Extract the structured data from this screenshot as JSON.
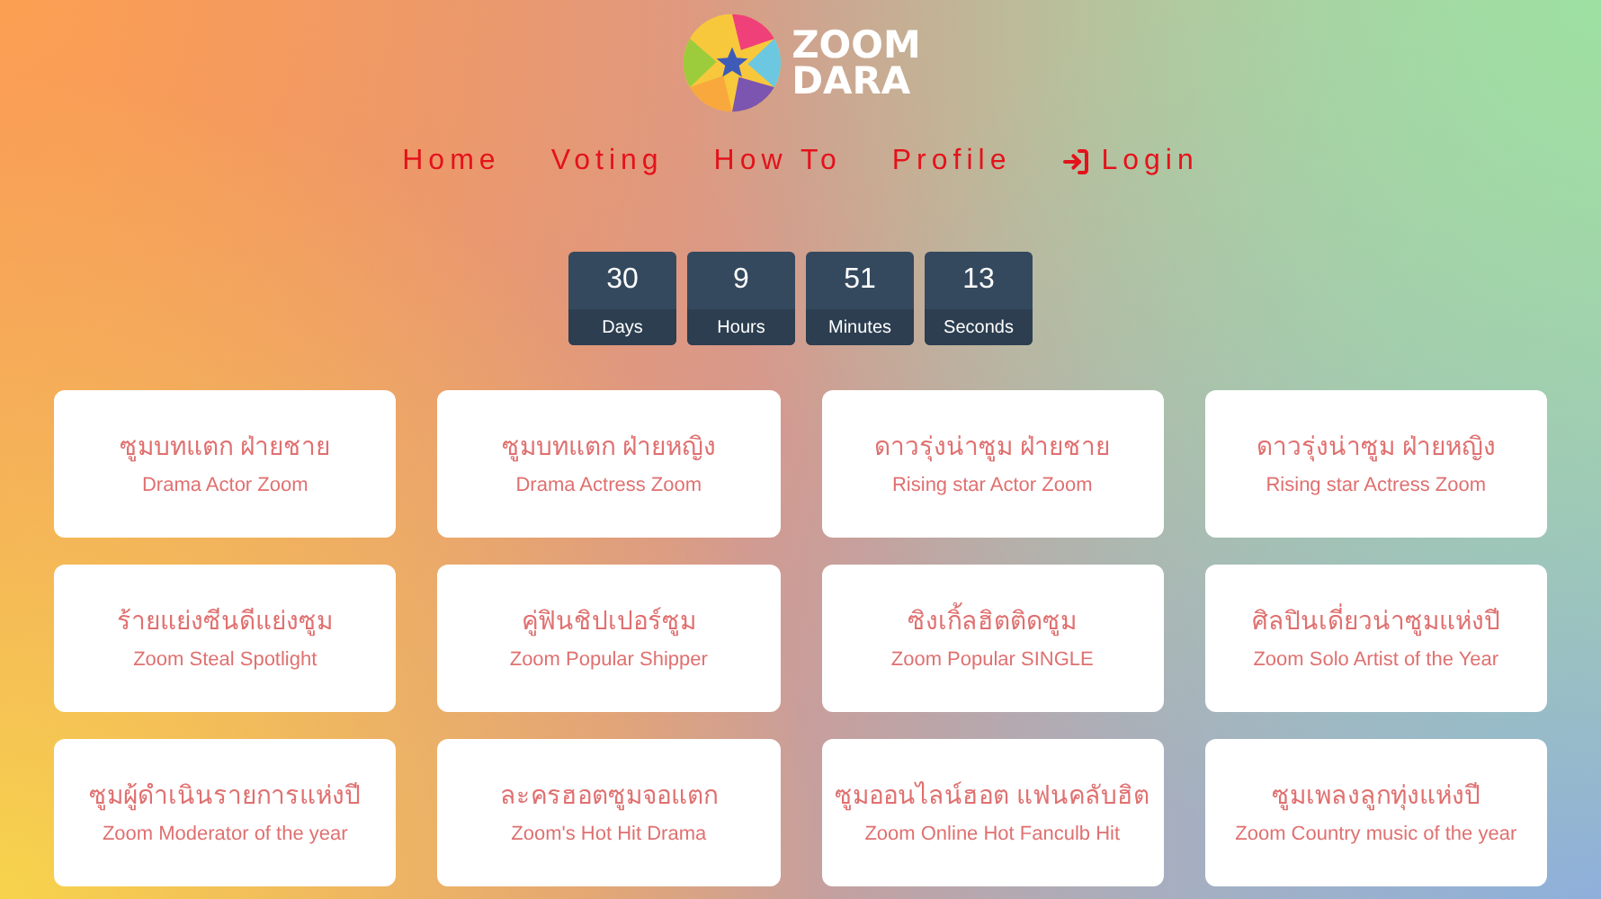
{
  "logo": {
    "line_1": "ZOOM",
    "line_2": "DARA"
  },
  "nav": [
    {
      "label": "Home",
      "kind": "text"
    },
    {
      "label": "Voting",
      "kind": "text"
    },
    {
      "label": "How To",
      "kind": "text"
    },
    {
      "label": "Profile",
      "kind": "text"
    },
    {
      "label": "Login",
      "kind": "login"
    }
  ],
  "countdown": [
    {
      "value": "30",
      "unit": "Days"
    },
    {
      "value": "9",
      "unit": "Hours"
    },
    {
      "value": "51",
      "unit": "Minutes"
    },
    {
      "value": "13",
      "unit": "Seconds"
    }
  ],
  "categories": [
    {
      "title": "ซูมบทแตก ฝ่ายชาย",
      "subtitle": "Drama Actor Zoom"
    },
    {
      "title": "ซูมบทแตก ฝ่ายหญิง",
      "subtitle": "Drama Actress Zoom"
    },
    {
      "title": "ดาวรุ่งน่าซูม ฝ่ายชาย",
      "subtitle": "Rising star Actor Zoom"
    },
    {
      "title": "ดาวรุ่งน่าซูม ฝ่ายหญิง",
      "subtitle": "Rising star Actress Zoom"
    },
    {
      "title": "ร้ายแย่งซีนดีแย่งซูม",
      "subtitle": "Zoom Steal Spotlight"
    },
    {
      "title": "คู่ฟินชิปเปอร์ซูม",
      "subtitle": "Zoom Popular Shipper"
    },
    {
      "title": "ซิงเกิ้ลฮิตติดซูม",
      "subtitle": "Zoom Popular SINGLE"
    },
    {
      "title": "ศิลปินเดี่ยวน่าซูมแห่งปี",
      "subtitle": "Zoom Solo Artist of the Year"
    },
    {
      "title": "ซูมผู้ดำเนินรายการแห่งปี",
      "subtitle": "Zoom Moderator of the year"
    },
    {
      "title": "ละครฮอตซูมจอแตก",
      "subtitle": "Zoom's Hot Hit Drama"
    },
    {
      "title": "ซูมออนไลน์ฮอต แฟนคลับฮิต",
      "subtitle": "Zoom Online Hot Fanculb Hit"
    },
    {
      "title": "ซูมเพลงลูกทุ่งแห่งปี",
      "subtitle": "Zoom Country music of the year"
    }
  ]
}
